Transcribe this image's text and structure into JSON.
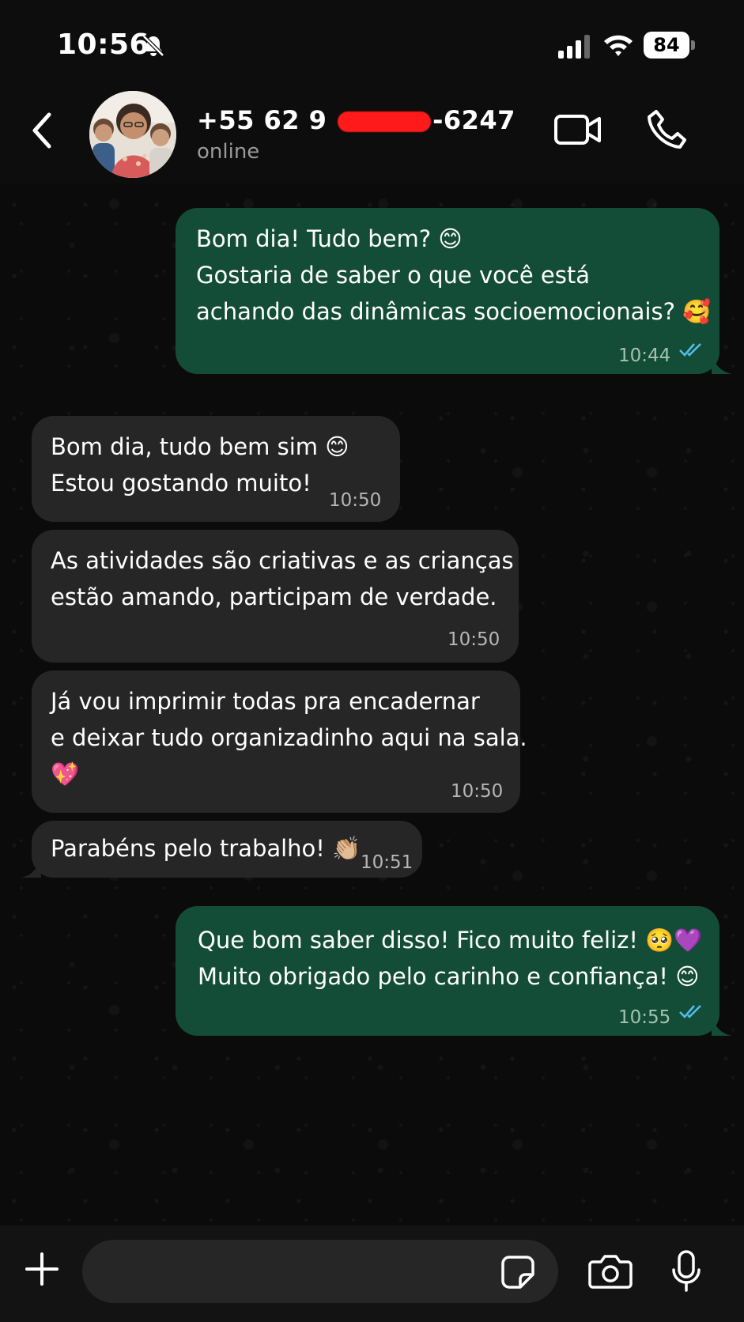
{
  "status_bar": {
    "time": "10:56",
    "battery": "84"
  },
  "header": {
    "contact_prefix": "+55 62 9 ",
    "contact_suffix": "-6247",
    "status": "online"
  },
  "messages": [
    {
      "direction": "out",
      "lines": [
        "Bom dia! Tudo bem? 😊",
        "Gostaria de saber o que você está",
        "achando das dinâmicas socioemocionais? 🥰"
      ],
      "time": "10:44",
      "ticks": "read"
    },
    {
      "direction": "in",
      "lines": [
        "Bom dia, tudo bem sim 😊",
        "Estou gostando muito!"
      ],
      "time": "10:50"
    },
    {
      "direction": "in",
      "lines": [
        "As atividades são criativas e as crianças",
        "estão amando, participam de verdade."
      ],
      "time": "10:50"
    },
    {
      "direction": "in",
      "lines": [
        "Já vou imprimir todas pra encadernar",
        "e deixar tudo organizadinho aqui na sala.",
        "💖"
      ],
      "time": "10:50"
    },
    {
      "direction": "in",
      "lines": [
        "Parabéns pelo trabalho! 👏🏼"
      ],
      "time": "10:51"
    },
    {
      "direction": "out",
      "lines": [
        "Que bom saber disso! Fico muito feliz! 🥺💜",
        "Muito obrigado pelo carinho e confiança! 😊"
      ],
      "time": "10:55",
      "ticks": "read"
    }
  ],
  "composer": {
    "placeholder": ""
  },
  "colors": {
    "outgoing_bubble": "#134d37",
    "incoming_bubble": "#262626",
    "read_ticks": "#53bdeb"
  }
}
